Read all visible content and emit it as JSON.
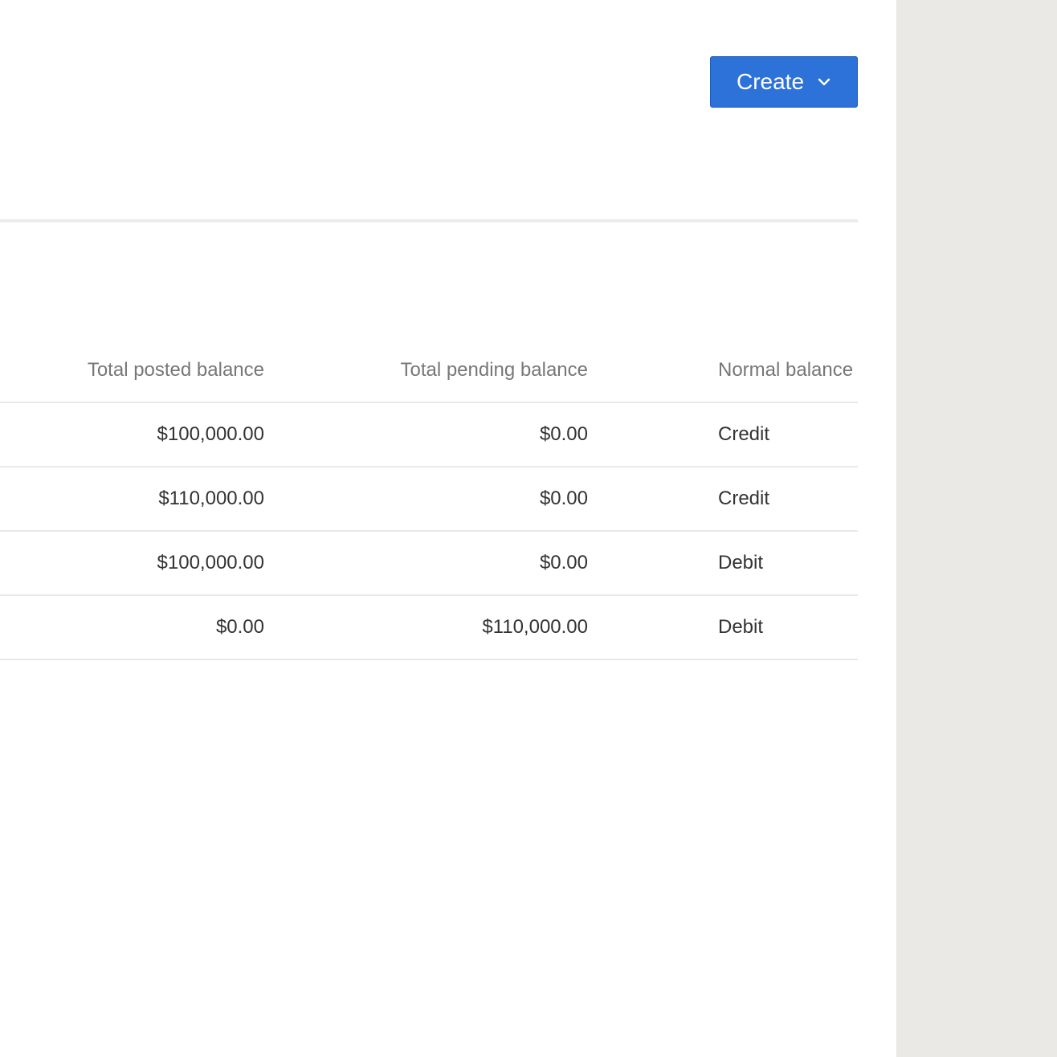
{
  "header": {
    "create_label": "Create",
    "create_icon": "chevron-down-icon"
  },
  "colors": {
    "accent": "#2d72d9",
    "side_panel": "#ebe9e5"
  },
  "table": {
    "columns": [
      "Total posted balance",
      "Total pending balance",
      "Normal balance"
    ],
    "rows": [
      {
        "posted": "$100,000.00",
        "pending": "$0.00",
        "normal": "Credit"
      },
      {
        "posted": "$110,000.00",
        "pending": "$0.00",
        "normal": "Credit"
      },
      {
        "posted": "$100,000.00",
        "pending": "$0.00",
        "normal": "Debit"
      },
      {
        "posted": "$0.00",
        "pending": "$110,000.00",
        "normal": "Debit"
      }
    ]
  }
}
